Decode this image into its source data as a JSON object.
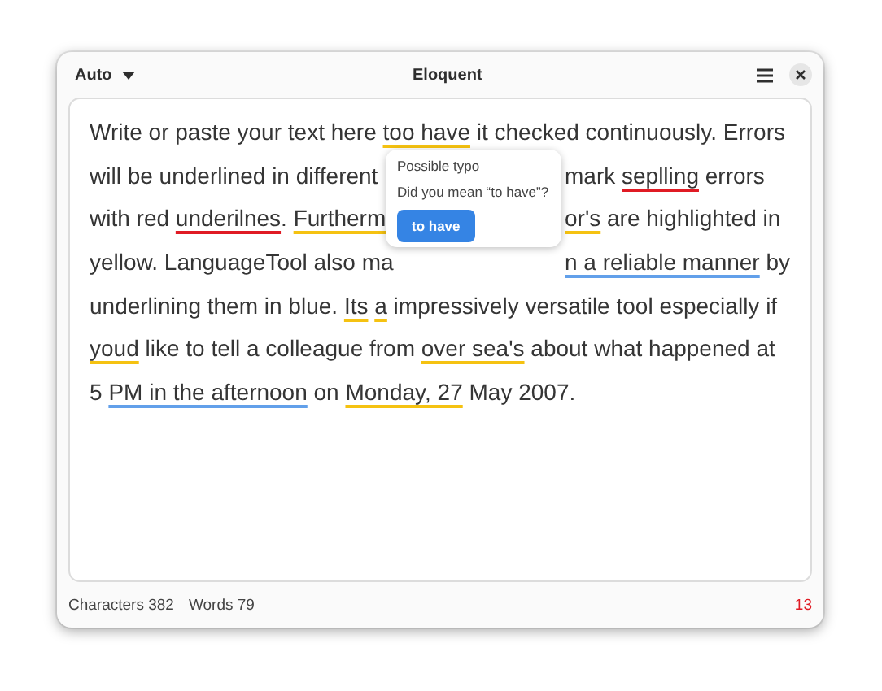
{
  "header": {
    "mode": "Auto",
    "title": "Eloquent"
  },
  "editor": {
    "lines": [
      {
        "left": [
          {
            "text": "Write or paste your text here ",
            "kind": "plain"
          },
          {
            "text": "too have",
            "kind": "grammar"
          },
          {
            "text": " it checked continuously. Errors",
            "kind": "plain"
          }
        ]
      },
      {
        "left": [
          {
            "text": "will be underlined in different",
            "kind": "plain"
          }
        ],
        "right": [
          {
            "text": "mark ",
            "kind": "plain"
          },
          {
            "text": "seplling",
            "kind": "spelling"
          },
          {
            "text": " errors",
            "kind": "plain"
          }
        ]
      },
      {
        "left": [
          {
            "text": "with red ",
            "kind": "plain"
          },
          {
            "text": "underilnes",
            "kind": "spelling",
            "trail": "."
          },
          {
            "text": "Furtherm",
            "kind": "grammar",
            "spaced": true
          }
        ],
        "right": [
          {
            "text": "or's",
            "kind": "grammar"
          },
          {
            "text": " are highlighted in",
            "kind": "plain"
          }
        ]
      },
      {
        "left": [
          {
            "text": "yellow. LanguageTool also ma",
            "kind": "plain"
          }
        ],
        "right": [
          {
            "text": "n a reliable manner",
            "kind": "style"
          },
          {
            "text": " by",
            "kind": "plain"
          }
        ]
      },
      {
        "left": [
          {
            "text": "underlining them in blue. ",
            "kind": "plain"
          },
          {
            "text": "Its",
            "kind": "grammar"
          },
          {
            "text": "a",
            "kind": "grammar",
            "spaced": true
          },
          {
            "text": " impressively versatile tool especially if",
            "kind": "plain"
          }
        ]
      },
      {
        "left": [
          {
            "text": "youd",
            "kind": "grammar"
          },
          {
            "text": " like to tell a colleague from ",
            "kind": "plain"
          },
          {
            "text": "over sea's",
            "kind": "grammar"
          },
          {
            "text": " about what happened at",
            "kind": "plain"
          }
        ]
      },
      {
        "left": [
          {
            "text": "5 ",
            "kind": "plain"
          },
          {
            "text": "PM in the afternoon",
            "kind": "style"
          },
          {
            "text": " on ",
            "kind": "plain"
          },
          {
            "text": "Monday, 27",
            "kind": "grammar"
          },
          {
            "text": " May 2007.",
            "kind": "plain"
          }
        ]
      }
    ]
  },
  "popover": {
    "title": "Possible typo",
    "question": "Did you mean “to have”?",
    "suggestion": "to have"
  },
  "footer": {
    "characters": "Characters 382",
    "words": "Words 79",
    "issues": "13"
  }
}
